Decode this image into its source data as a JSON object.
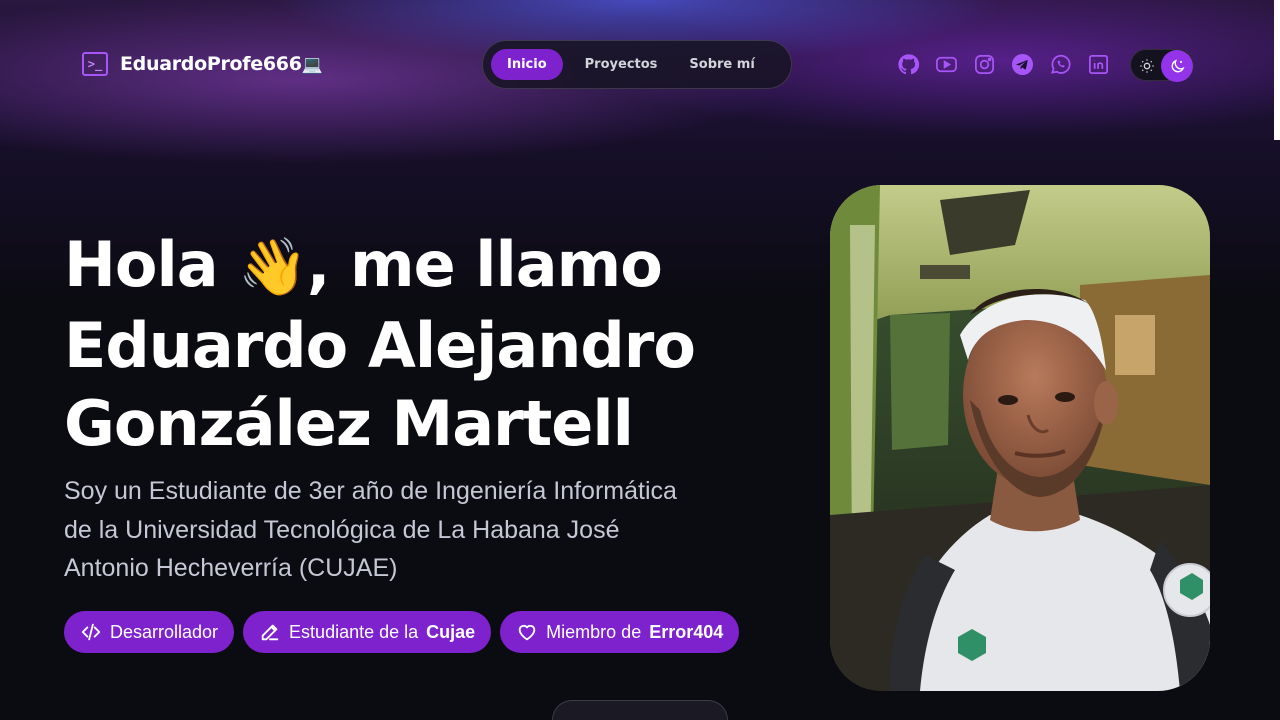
{
  "header": {
    "logo_icon": ">_",
    "logo_text": "EduardoProfe666",
    "logo_emoji": "💻"
  },
  "nav": {
    "items": [
      {
        "label": "Inicio",
        "active": true
      },
      {
        "label": "Proyectos",
        "active": false
      },
      {
        "label": "Sobre mí",
        "active": false
      }
    ]
  },
  "socials": [
    "github-icon",
    "youtube-icon",
    "instagram-icon",
    "telegram-icon",
    "whatsapp-icon",
    "linkedin-icon"
  ],
  "theme_toggle": {
    "modes": [
      "light",
      "dark"
    ],
    "active": "dark"
  },
  "hero": {
    "title_start": "Hola",
    "wave_emoji": "👋",
    "title_rest": ", me llamo",
    "name_line_1": "Eduardo Alejandro",
    "name_line_2": "González Martell",
    "subtitle": "Soy un Estudiante de 3er año de Ingeniería Informática de la Universidad Tecnológica de La Habana José Antonio Hecheverría (CUJAE)"
  },
  "badges": [
    {
      "icon": "code-icon",
      "prefix": "Desarrollador",
      "highlight": ""
    },
    {
      "icon": "pencil-icon",
      "prefix": "Estudiante de la",
      "highlight": "Cujae"
    },
    {
      "icon": "heart-icon",
      "prefix": "Miembro de",
      "highlight": "Error404"
    }
  ],
  "colors": {
    "accent": "#7e22ce",
    "accent_light": "#a855f7",
    "background": "#0b0b12"
  }
}
